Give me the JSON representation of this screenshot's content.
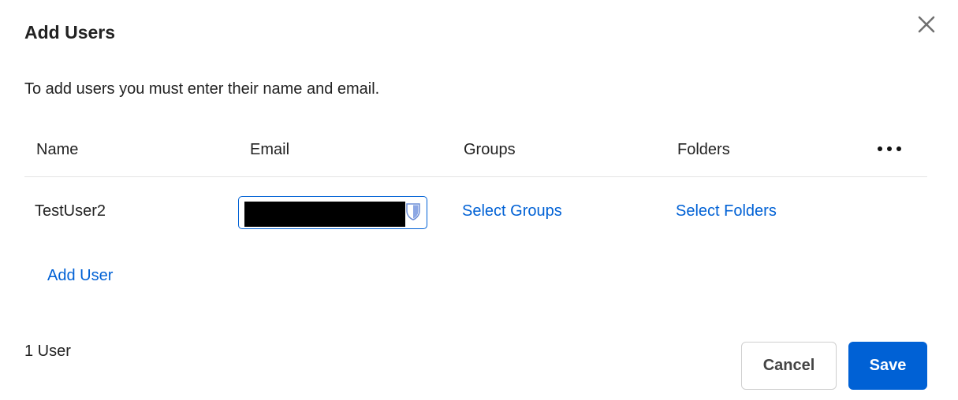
{
  "dialog": {
    "title": "Add Users",
    "instructions": "To add users you must enter their name and email.",
    "close_icon": "close-icon"
  },
  "table": {
    "headers": {
      "name": "Name",
      "email": "Email",
      "groups": "Groups",
      "folders": "Folders"
    },
    "more_icon": "more-horizontal-icon",
    "rows": [
      {
        "name": "TestUser2",
        "email": "",
        "groups_link": "Select Groups",
        "folders_link": "Select Folders"
      }
    ]
  },
  "add_user_label": "Add User",
  "footer": {
    "user_count": "1 User",
    "cancel_label": "Cancel",
    "save_label": "Save"
  },
  "colors": {
    "accent": "#0061d5",
    "text": "#222222",
    "divider": "#e4e4e4"
  }
}
